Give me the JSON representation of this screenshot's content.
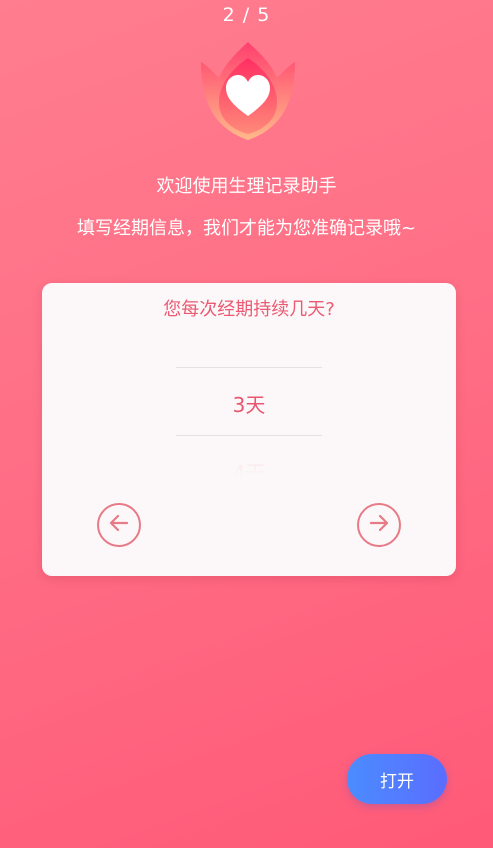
{
  "header": {
    "page_indicator": "2 / 5"
  },
  "welcome": {
    "line1": "欢迎使用生理记录助手",
    "line2": "填写经期信息，我们才能为您准确记录哦~"
  },
  "card": {
    "question": "您每次经期持续几天?",
    "picker": {
      "selected": "3天",
      "next": "4天"
    }
  },
  "footer": {
    "open_label": "打开"
  },
  "colors": {
    "background": "#ff6f86",
    "accent": "#e9566f",
    "button": "#4b8cff"
  },
  "icons": {
    "logo": "heart-lotus-icon",
    "prev": "arrow-left-icon",
    "next": "arrow-right-icon"
  }
}
